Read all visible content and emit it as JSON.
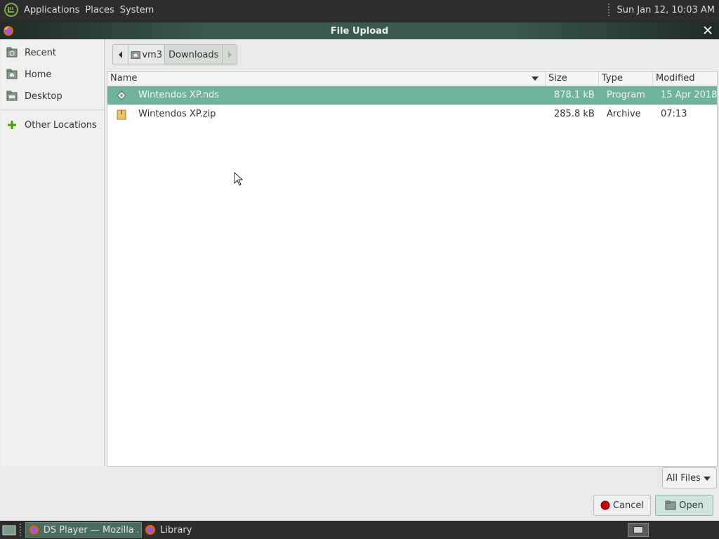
{
  "top_panel": {
    "menus": [
      "Applications",
      "Places",
      "System"
    ],
    "clock": "Sun Jan 12, 10:03 AM"
  },
  "window": {
    "title": "File Upload"
  },
  "sidebar": {
    "items": [
      {
        "label": "Recent",
        "icon": "recent-icon"
      },
      {
        "label": "Home",
        "icon": "home-folder-icon"
      },
      {
        "label": "Desktop",
        "icon": "desktop-folder-icon"
      },
      {
        "label": "Other Locations",
        "icon": "plus-icon"
      }
    ]
  },
  "pathbar": {
    "segments": [
      "vm3",
      "Downloads"
    ]
  },
  "filelist": {
    "columns": [
      "Name",
      "Size",
      "Type",
      "Modified"
    ],
    "sort_column": "Name",
    "rows": [
      {
        "name": "Wintendos XP.nds",
        "size": "878.1 kB",
        "type": "Program",
        "modified": "15 Apr 2018",
        "icon": "program-file-icon",
        "selected": true
      },
      {
        "name": "Wintendos XP.zip",
        "size": "285.8 kB",
        "type": "Archive",
        "modified": "07:13",
        "icon": "archive-file-icon",
        "selected": false
      }
    ]
  },
  "filter": {
    "selected": "All Files"
  },
  "buttons": {
    "cancel": "Cancel",
    "open": "Open"
  },
  "taskbar": {
    "tasks": [
      {
        "label": "DS Player — Mozilla ...",
        "active": true
      },
      {
        "label": "Library",
        "active": false
      }
    ]
  },
  "colors": {
    "selection": "#6fb29e",
    "titlebar": "#3b5a4f",
    "panel": "#2d2d2d"
  }
}
